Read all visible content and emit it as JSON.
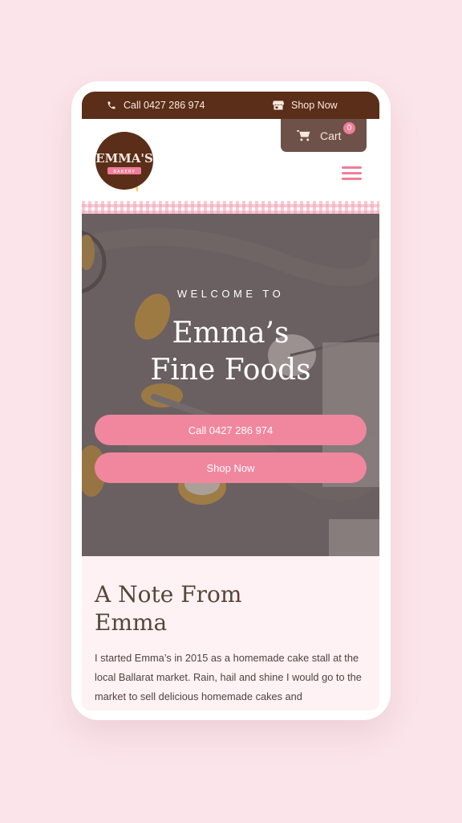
{
  "topbar": {
    "call_label": "Call 0427 286 974",
    "shop_label": "Shop Now"
  },
  "header": {
    "logo_text": "EMMA'S",
    "logo_subtext": "BAKERY",
    "cart_label": "Cart",
    "cart_count": "0"
  },
  "hero": {
    "welcome": "WELCOME TO",
    "title_line1": "Emma’s",
    "title_line2": "Fine Foods",
    "call_button": "Call 0427 286 974",
    "shop_button": "Shop Now"
  },
  "note": {
    "heading_line1": "A Note From",
    "heading_line2": "Emma",
    "body": "I started Emma’s in 2015 as a homemade cake stall at the local Ballarat market. Rain, hail and shine I would go to the market to sell delicious homemade cakes and"
  },
  "icons": {
    "phone": "phone-icon",
    "shop": "store-icon",
    "cart": "cart-icon",
    "menu": "hamburger-menu-icon"
  },
  "colors": {
    "page_background": "#fbe4ea",
    "topbar": "#5a2e18",
    "cart_button": "#6e5148",
    "accent_pink": "#f0879f",
    "heading_brown": "#5a4637"
  }
}
